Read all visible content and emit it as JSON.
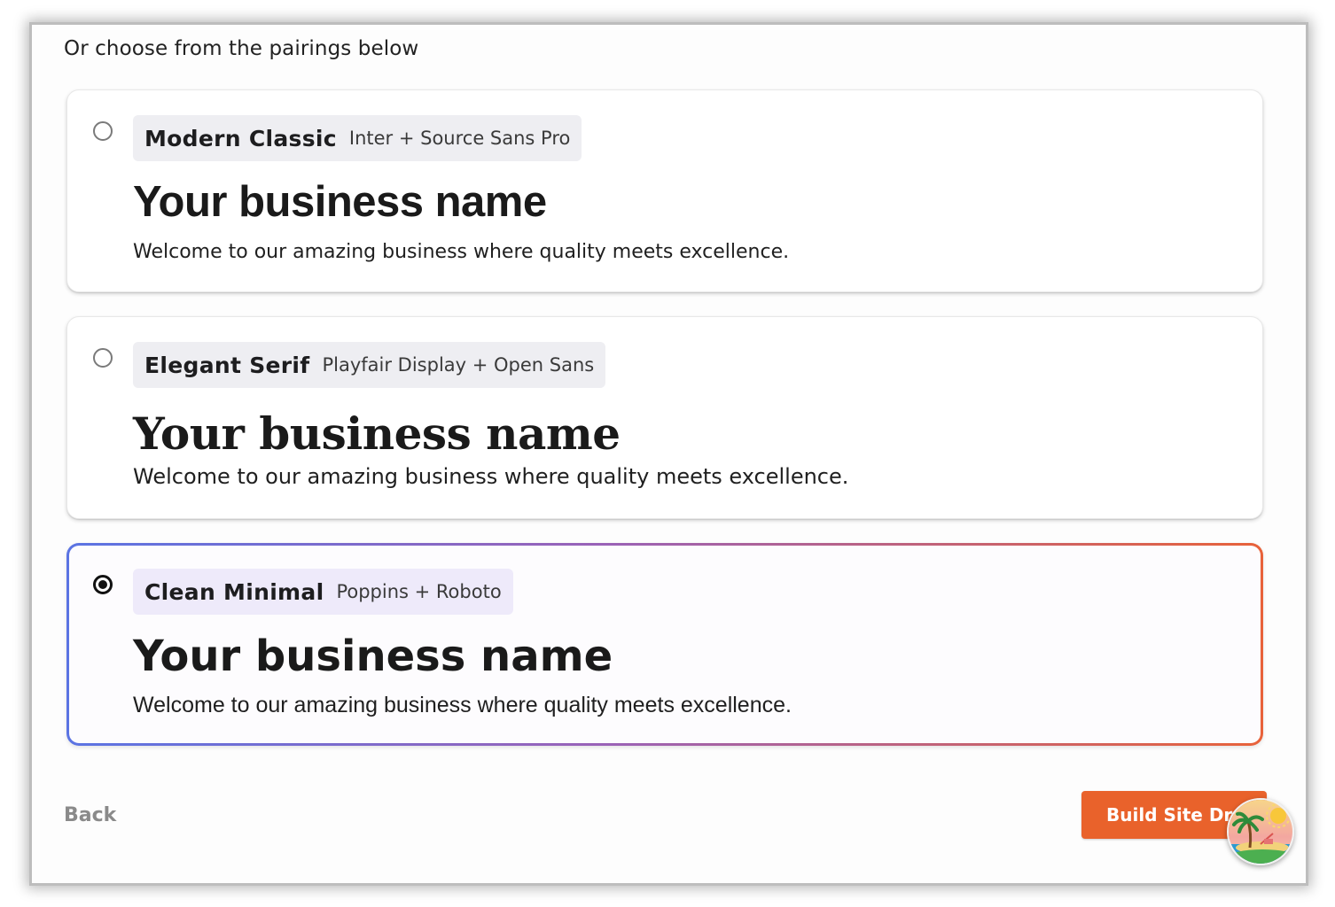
{
  "intro_text": "Or choose from the pairings below",
  "pairings": [
    {
      "name": "Modern Classic",
      "fonts": "Inter + Source Sans Pro",
      "heading": "Your business name",
      "tagline": "Welcome to our amazing business where quality meets excellence.",
      "selected": false
    },
    {
      "name": "Elegant Serif",
      "fonts": "Playfair Display + Open Sans",
      "heading": "Your business name",
      "tagline": "Welcome to our amazing business where quality meets excellence.",
      "selected": false
    },
    {
      "name": "Clean Minimal",
      "fonts": "Poppins + Roboto",
      "heading": "Your business name",
      "tagline": "Welcome to our amazing business where quality meets excellence.",
      "selected": true
    }
  ],
  "footer": {
    "back_label": "Back",
    "build_label": "Build Site Draft"
  },
  "avatar_icon": "beach-island-icon",
  "colors": {
    "accent_orange": "#e9622b",
    "selected_gradient_start": "#5b74e3",
    "selected_gradient_end": "#e8623a"
  }
}
